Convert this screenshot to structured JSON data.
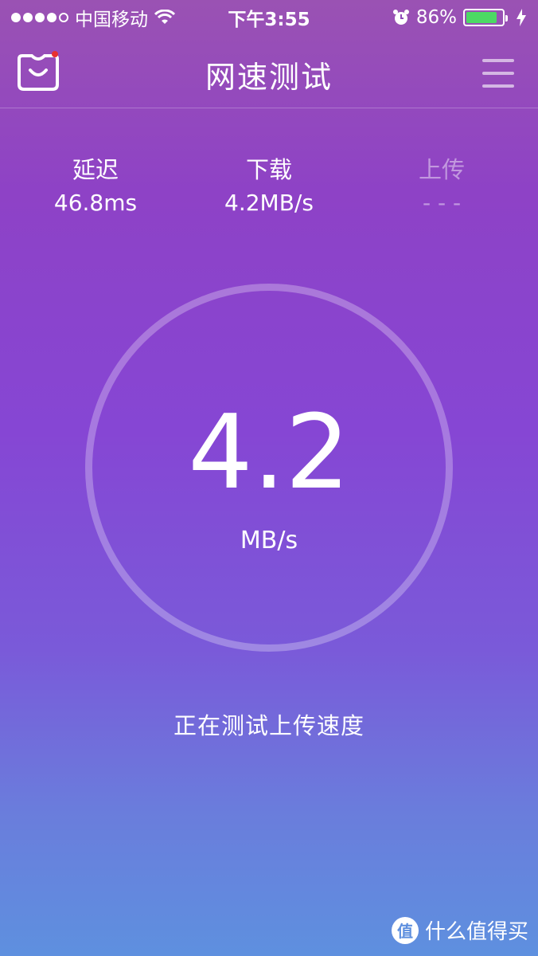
{
  "status_bar": {
    "carrier": "中国移动",
    "time": "下午3:55",
    "battery_percent": "86%",
    "battery_level": 0.86,
    "icons": [
      "signal-icon",
      "wifi-icon",
      "alarm-icon",
      "battery-icon",
      "charging-icon"
    ]
  },
  "nav": {
    "title": "网速测试",
    "left_icon": "shopping-bag-icon",
    "right_icon": "menu-icon"
  },
  "stats": {
    "latency": {
      "label": "延迟",
      "value": "46.8ms"
    },
    "download": {
      "label": "下载",
      "value": "4.2MB/s"
    },
    "upload": {
      "label": "上传",
      "value": "- - -"
    }
  },
  "gauge": {
    "value": "4.2",
    "unit": "MB/s"
  },
  "status_message": "正在测试上传速度",
  "watermark": {
    "badge": "值",
    "text": "什么值得买"
  },
  "colors": {
    "gradient_top": "#9a52b3",
    "gradient_bottom": "#5e90df",
    "battery_green": "#4cd964",
    "notification_dot": "#e8312f"
  }
}
